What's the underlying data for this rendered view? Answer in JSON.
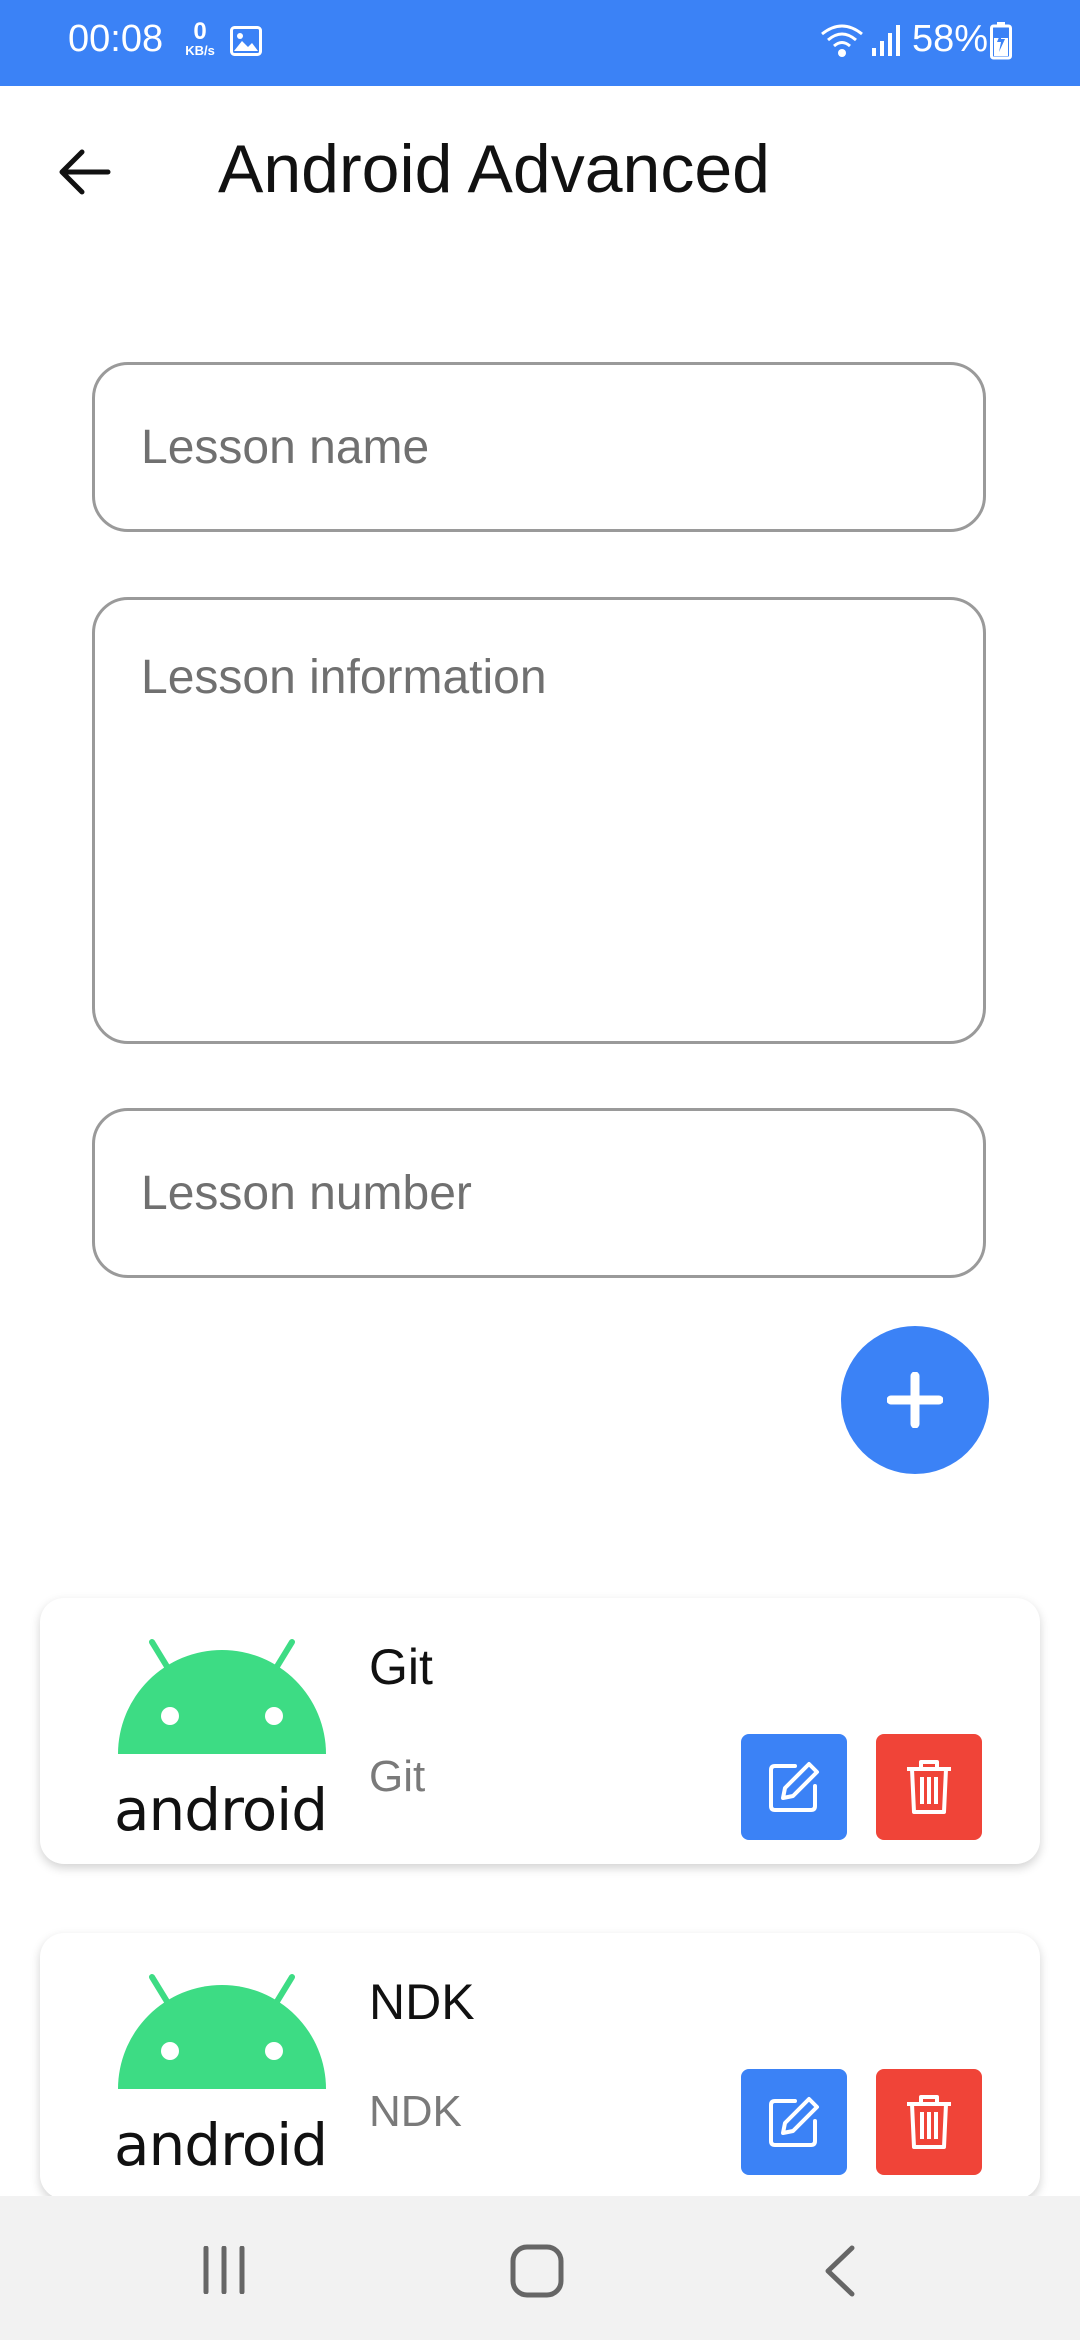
{
  "status_bar": {
    "time": "00:08",
    "net_speed_value": "0",
    "net_speed_unit": "KB/s",
    "battery": "58%",
    "color": "#3b82f6"
  },
  "header": {
    "title": "Android Advanced",
    "back_icon": "arrow-left-icon"
  },
  "form": {
    "lesson_name": {
      "value": "",
      "placeholder": "Lesson name"
    },
    "lesson_information": {
      "value": "",
      "placeholder": "Lesson information"
    },
    "lesson_number": {
      "value": "",
      "placeholder": "Lesson number"
    },
    "add_icon": "plus-icon"
  },
  "lessons": [
    {
      "title": "Git",
      "subtitle": "Git",
      "logo_text": "android"
    },
    {
      "title": "NDK",
      "subtitle": "NDK",
      "logo_text": "android"
    }
  ],
  "colors": {
    "primary": "#3b82f6",
    "danger": "#f04438",
    "android_green": "#3ddc84"
  },
  "nav_bar": {
    "icons": [
      "recent-apps-icon",
      "home-icon",
      "back-icon"
    ]
  }
}
